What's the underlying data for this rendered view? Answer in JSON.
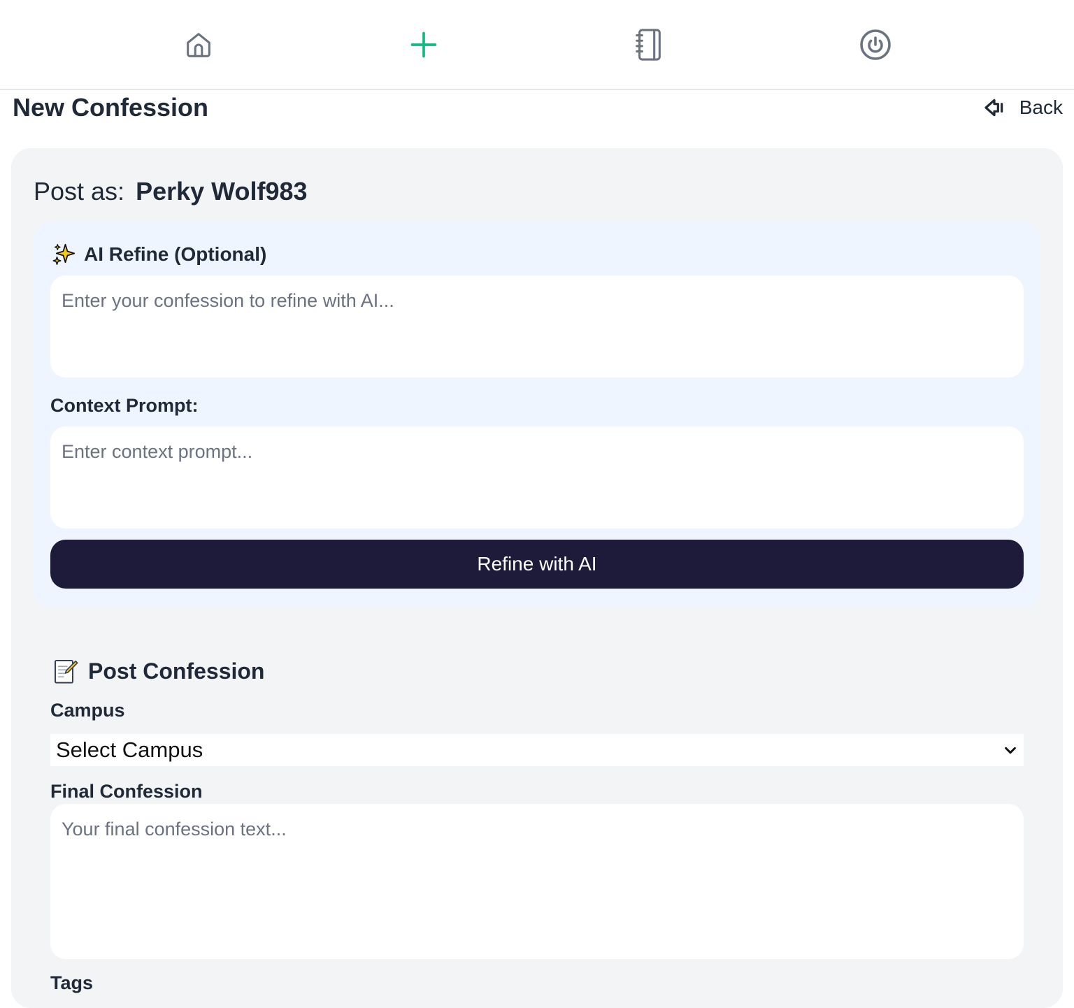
{
  "nav": {
    "items": [
      {
        "icon": "home-icon",
        "active": false
      },
      {
        "icon": "plus-icon",
        "active": true
      },
      {
        "icon": "notebook-icon",
        "active": false
      },
      {
        "icon": "power-icon",
        "active": false
      }
    ],
    "active_color": "#10b981",
    "inactive_color": "#6b7280"
  },
  "header": {
    "title": "New Confession",
    "back_label": "Back",
    "back_icon": "arrow-left-icon"
  },
  "post_as": {
    "label": "Post as:",
    "name": "Perky Wolf983"
  },
  "ai_refine": {
    "icon": "sparkles-icon",
    "title": "AI Refine (Optional)",
    "confession_placeholder": "Enter your confession to refine with AI...",
    "context_label": "Context Prompt:",
    "context_placeholder": "Enter context prompt...",
    "button_label": "Refine with AI",
    "button_color": "#1e1b3a"
  },
  "post_confession": {
    "icon": "memo-icon",
    "title": "Post Confession",
    "campus_label": "Campus",
    "campus_selected": "Select Campus",
    "final_label": "Final Confession",
    "final_placeholder": "Your final confession text...",
    "tags_label": "Tags"
  }
}
